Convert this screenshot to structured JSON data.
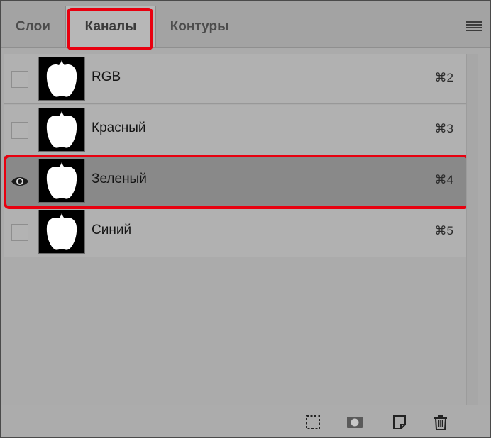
{
  "tabs": [
    {
      "label": "Слои",
      "active": false
    },
    {
      "label": "Каналы",
      "active": true
    },
    {
      "label": "Контуры",
      "active": false
    }
  ],
  "channels": [
    {
      "name": "RGB",
      "shortcut": "⌘2",
      "visible": false,
      "selected": false
    },
    {
      "name": "Красный",
      "shortcut": "⌘3",
      "visible": false,
      "selected": false
    },
    {
      "name": "Зеленый",
      "shortcut": "⌘4",
      "visible": true,
      "selected": true
    },
    {
      "name": "Синий",
      "shortcut": "⌘5",
      "visible": false,
      "selected": false
    }
  ],
  "icons": {
    "panel_menu": "hamburger-menu-icon",
    "visibility_on": "eye-icon",
    "load_selection": "dashed-selection-icon",
    "save_mask": "mask-icon",
    "new_channel": "new-page-icon",
    "delete": "trash-icon"
  },
  "colors": {
    "highlight": "#e8000f",
    "panel_bg": "#ababab",
    "selected_row": "#898989"
  }
}
